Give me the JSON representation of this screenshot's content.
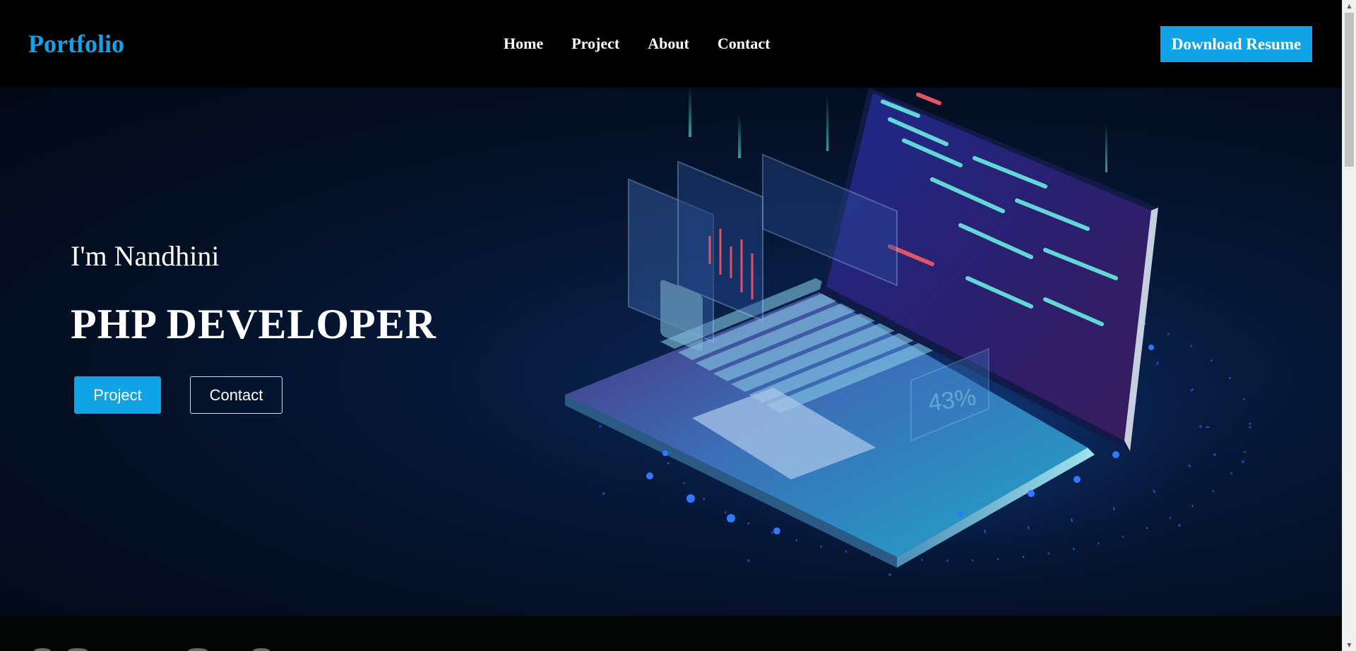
{
  "navbar": {
    "logo": "Portfolio",
    "links": [
      "Home",
      "Project",
      "About",
      "Contact"
    ],
    "resume_button": "Download Resume"
  },
  "hero": {
    "greeting": "I'm Nandhini",
    "role": "PHP DEVELOPER",
    "project_button": "Project",
    "contact_button": "Contact",
    "illustration": "laptop-code-illustration",
    "screen_readout": "43%"
  },
  "colors": {
    "accent": "#10a3e6",
    "navbar_bg": "#000000",
    "hero_bg": "#061838",
    "text": "#ffffff"
  },
  "scrollbar": {
    "up_icon": "scroll-up-arrow-icon",
    "down_icon": "scroll-down-arrow-icon"
  }
}
